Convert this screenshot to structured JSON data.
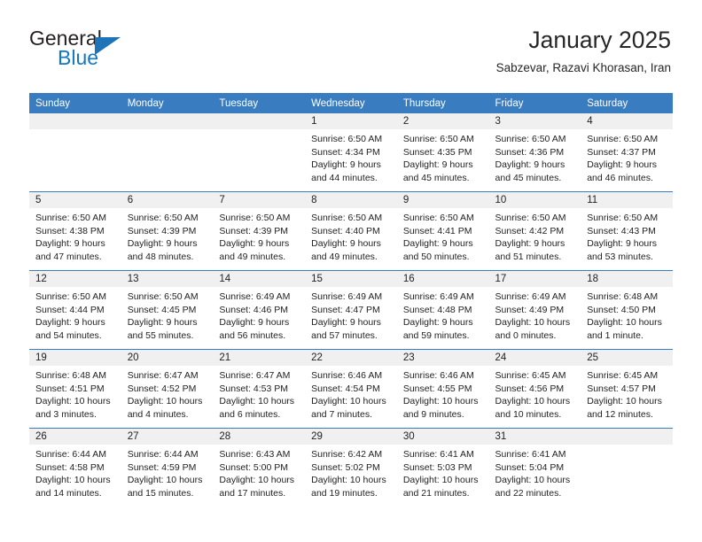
{
  "brand": {
    "word_top": "General",
    "word_bottom": "Blue",
    "triangle_color": "#1f73b8",
    "blue_color": "#1277c4"
  },
  "header": {
    "title": "January 2025",
    "subtitle": "Sabzevar, Razavi Khorasan, Iran"
  },
  "theme": {
    "header_bg": "#3a7cc0",
    "daynum_bg": "#f0f0f0",
    "text": "#222222"
  },
  "weekday_headers": [
    "Sunday",
    "Monday",
    "Tuesday",
    "Wednesday",
    "Thursday",
    "Friday",
    "Saturday"
  ],
  "weeks": [
    [
      {
        "day": "",
        "empty": true,
        "sunrise": "",
        "sunset": "",
        "daylight_line1": "",
        "daylight_line2": ""
      },
      {
        "day": "",
        "empty": true,
        "sunrise": "",
        "sunset": "",
        "daylight_line1": "",
        "daylight_line2": ""
      },
      {
        "day": "",
        "empty": true,
        "sunrise": "",
        "sunset": "",
        "daylight_line1": "",
        "daylight_line2": ""
      },
      {
        "day": "1",
        "empty": false,
        "sunrise": "Sunrise: 6:50 AM",
        "sunset": "Sunset: 4:34 PM",
        "daylight_line1": "Daylight: 9 hours",
        "daylight_line2": "and 44 minutes."
      },
      {
        "day": "2",
        "empty": false,
        "sunrise": "Sunrise: 6:50 AM",
        "sunset": "Sunset: 4:35 PM",
        "daylight_line1": "Daylight: 9 hours",
        "daylight_line2": "and 45 minutes."
      },
      {
        "day": "3",
        "empty": false,
        "sunrise": "Sunrise: 6:50 AM",
        "sunset": "Sunset: 4:36 PM",
        "daylight_line1": "Daylight: 9 hours",
        "daylight_line2": "and 45 minutes."
      },
      {
        "day": "4",
        "empty": false,
        "sunrise": "Sunrise: 6:50 AM",
        "sunset": "Sunset: 4:37 PM",
        "daylight_line1": "Daylight: 9 hours",
        "daylight_line2": "and 46 minutes."
      }
    ],
    [
      {
        "day": "5",
        "empty": false,
        "sunrise": "Sunrise: 6:50 AM",
        "sunset": "Sunset: 4:38 PM",
        "daylight_line1": "Daylight: 9 hours",
        "daylight_line2": "and 47 minutes."
      },
      {
        "day": "6",
        "empty": false,
        "sunrise": "Sunrise: 6:50 AM",
        "sunset": "Sunset: 4:39 PM",
        "daylight_line1": "Daylight: 9 hours",
        "daylight_line2": "and 48 minutes."
      },
      {
        "day": "7",
        "empty": false,
        "sunrise": "Sunrise: 6:50 AM",
        "sunset": "Sunset: 4:39 PM",
        "daylight_line1": "Daylight: 9 hours",
        "daylight_line2": "and 49 minutes."
      },
      {
        "day": "8",
        "empty": false,
        "sunrise": "Sunrise: 6:50 AM",
        "sunset": "Sunset: 4:40 PM",
        "daylight_line1": "Daylight: 9 hours",
        "daylight_line2": "and 49 minutes."
      },
      {
        "day": "9",
        "empty": false,
        "sunrise": "Sunrise: 6:50 AM",
        "sunset": "Sunset: 4:41 PM",
        "daylight_line1": "Daylight: 9 hours",
        "daylight_line2": "and 50 minutes."
      },
      {
        "day": "10",
        "empty": false,
        "sunrise": "Sunrise: 6:50 AM",
        "sunset": "Sunset: 4:42 PM",
        "daylight_line1": "Daylight: 9 hours",
        "daylight_line2": "and 51 minutes."
      },
      {
        "day": "11",
        "empty": false,
        "sunrise": "Sunrise: 6:50 AM",
        "sunset": "Sunset: 4:43 PM",
        "daylight_line1": "Daylight: 9 hours",
        "daylight_line2": "and 53 minutes."
      }
    ],
    [
      {
        "day": "12",
        "empty": false,
        "sunrise": "Sunrise: 6:50 AM",
        "sunset": "Sunset: 4:44 PM",
        "daylight_line1": "Daylight: 9 hours",
        "daylight_line2": "and 54 minutes."
      },
      {
        "day": "13",
        "empty": false,
        "sunrise": "Sunrise: 6:50 AM",
        "sunset": "Sunset: 4:45 PM",
        "daylight_line1": "Daylight: 9 hours",
        "daylight_line2": "and 55 minutes."
      },
      {
        "day": "14",
        "empty": false,
        "sunrise": "Sunrise: 6:49 AM",
        "sunset": "Sunset: 4:46 PM",
        "daylight_line1": "Daylight: 9 hours",
        "daylight_line2": "and 56 minutes."
      },
      {
        "day": "15",
        "empty": false,
        "sunrise": "Sunrise: 6:49 AM",
        "sunset": "Sunset: 4:47 PM",
        "daylight_line1": "Daylight: 9 hours",
        "daylight_line2": "and 57 minutes."
      },
      {
        "day": "16",
        "empty": false,
        "sunrise": "Sunrise: 6:49 AM",
        "sunset": "Sunset: 4:48 PM",
        "daylight_line1": "Daylight: 9 hours",
        "daylight_line2": "and 59 minutes."
      },
      {
        "day": "17",
        "empty": false,
        "sunrise": "Sunrise: 6:49 AM",
        "sunset": "Sunset: 4:49 PM",
        "daylight_line1": "Daylight: 10 hours",
        "daylight_line2": "and 0 minutes."
      },
      {
        "day": "18",
        "empty": false,
        "sunrise": "Sunrise: 6:48 AM",
        "sunset": "Sunset: 4:50 PM",
        "daylight_line1": "Daylight: 10 hours",
        "daylight_line2": "and 1 minute."
      }
    ],
    [
      {
        "day": "19",
        "empty": false,
        "sunrise": "Sunrise: 6:48 AM",
        "sunset": "Sunset: 4:51 PM",
        "daylight_line1": "Daylight: 10 hours",
        "daylight_line2": "and 3 minutes."
      },
      {
        "day": "20",
        "empty": false,
        "sunrise": "Sunrise: 6:47 AM",
        "sunset": "Sunset: 4:52 PM",
        "daylight_line1": "Daylight: 10 hours",
        "daylight_line2": "and 4 minutes."
      },
      {
        "day": "21",
        "empty": false,
        "sunrise": "Sunrise: 6:47 AM",
        "sunset": "Sunset: 4:53 PM",
        "daylight_line1": "Daylight: 10 hours",
        "daylight_line2": "and 6 minutes."
      },
      {
        "day": "22",
        "empty": false,
        "sunrise": "Sunrise: 6:46 AM",
        "sunset": "Sunset: 4:54 PM",
        "daylight_line1": "Daylight: 10 hours",
        "daylight_line2": "and 7 minutes."
      },
      {
        "day": "23",
        "empty": false,
        "sunrise": "Sunrise: 6:46 AM",
        "sunset": "Sunset: 4:55 PM",
        "daylight_line1": "Daylight: 10 hours",
        "daylight_line2": "and 9 minutes."
      },
      {
        "day": "24",
        "empty": false,
        "sunrise": "Sunrise: 6:45 AM",
        "sunset": "Sunset: 4:56 PM",
        "daylight_line1": "Daylight: 10 hours",
        "daylight_line2": "and 10 minutes."
      },
      {
        "day": "25",
        "empty": false,
        "sunrise": "Sunrise: 6:45 AM",
        "sunset": "Sunset: 4:57 PM",
        "daylight_line1": "Daylight: 10 hours",
        "daylight_line2": "and 12 minutes."
      }
    ],
    [
      {
        "day": "26",
        "empty": false,
        "sunrise": "Sunrise: 6:44 AM",
        "sunset": "Sunset: 4:58 PM",
        "daylight_line1": "Daylight: 10 hours",
        "daylight_line2": "and 14 minutes."
      },
      {
        "day": "27",
        "empty": false,
        "sunrise": "Sunrise: 6:44 AM",
        "sunset": "Sunset: 4:59 PM",
        "daylight_line1": "Daylight: 10 hours",
        "daylight_line2": "and 15 minutes."
      },
      {
        "day": "28",
        "empty": false,
        "sunrise": "Sunrise: 6:43 AM",
        "sunset": "Sunset: 5:00 PM",
        "daylight_line1": "Daylight: 10 hours",
        "daylight_line2": "and 17 minutes."
      },
      {
        "day": "29",
        "empty": false,
        "sunrise": "Sunrise: 6:42 AM",
        "sunset": "Sunset: 5:02 PM",
        "daylight_line1": "Daylight: 10 hours",
        "daylight_line2": "and 19 minutes."
      },
      {
        "day": "30",
        "empty": false,
        "sunrise": "Sunrise: 6:41 AM",
        "sunset": "Sunset: 5:03 PM",
        "daylight_line1": "Daylight: 10 hours",
        "daylight_line2": "and 21 minutes."
      },
      {
        "day": "31",
        "empty": false,
        "sunrise": "Sunrise: 6:41 AM",
        "sunset": "Sunset: 5:04 PM",
        "daylight_line1": "Daylight: 10 hours",
        "daylight_line2": "and 22 minutes."
      },
      {
        "day": "",
        "empty": true,
        "sunrise": "",
        "sunset": "",
        "daylight_line1": "",
        "daylight_line2": ""
      }
    ]
  ]
}
